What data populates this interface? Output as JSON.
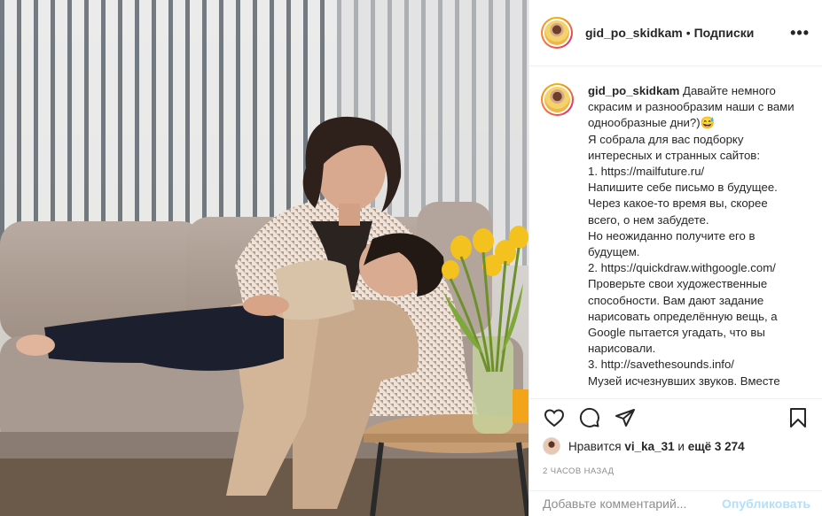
{
  "post": {
    "username": "gid_po_skidkam",
    "separator": "•",
    "follow_status": "Подписки",
    "more_icon": "more-horizontal-icon",
    "caption_username": "gid_po_skidkam",
    "caption_text": "Давайте немного скрасим и разнообразим наши с вами однообразные дни?)😅\nЯ собрала для вас подборку интересных и странных сайтов:\n1. https://mailfuture.ru/\nНапишите себе письмо в будущее. Через какое-то время вы, скорее всего, о нем забудете.\nНо неожиданно получите его в будущем.\n2. https://quickdraw.withgoogle.com/\nПроверьте свои художественные способности. Вам дают задание нарисовать определённую вещь, а Google пытается угадать, что вы нарисовали.\n3. http://savethesounds.info/\nМузей исчезнувших звуков. Вместе",
    "likes_prefix": "Нравится",
    "likes_user": "vi_ka_31",
    "likes_middle": "и",
    "likes_rest": "ещё 3 274",
    "time_ago": "2 ЧАСОВ НАЗАД",
    "comment_placeholder": "Добавьте комментарий...",
    "publish_label": "Опубликовать"
  },
  "icons": {
    "like": "heart-icon",
    "comment": "comment-icon",
    "share": "share-icon",
    "save": "bookmark-icon"
  },
  "colors": {
    "text": "#262626",
    "muted": "#8e8e8e",
    "publish_disabled": "#b2dffc",
    "divider": "#efefef"
  }
}
